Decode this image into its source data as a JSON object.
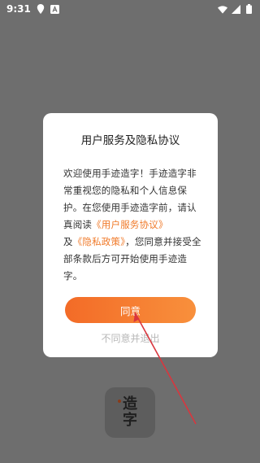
{
  "status_bar": {
    "time": "9:31",
    "left_icons": [
      "location-icon",
      "notification-a-icon"
    ],
    "right_icons": [
      "wifi-icon",
      "signal-icon",
      "battery-icon"
    ]
  },
  "dialog": {
    "title": "用户服务及隐私协议",
    "body_line1": "欢迎使用手迹造字！手迹造字非常重视您的隐私和个人信息保护。在您使用手迹造字前，请认真阅读",
    "terms_link": "《用户服务协议》",
    "and_text": "及",
    "privacy_link": "《隐私政策》",
    "body_line2": "，您同意并接受全部条款后方可开始使用手迹造字。",
    "agree_label": "同意",
    "disagree_label": "不同意并退出"
  },
  "app_icon": {
    "glyph_top": "造",
    "glyph_bottom": "字"
  },
  "colors": {
    "overlay": "#6e6e6e",
    "accent": "#f36b27",
    "link": "#f07a2a",
    "arrow": "#d9363e"
  }
}
